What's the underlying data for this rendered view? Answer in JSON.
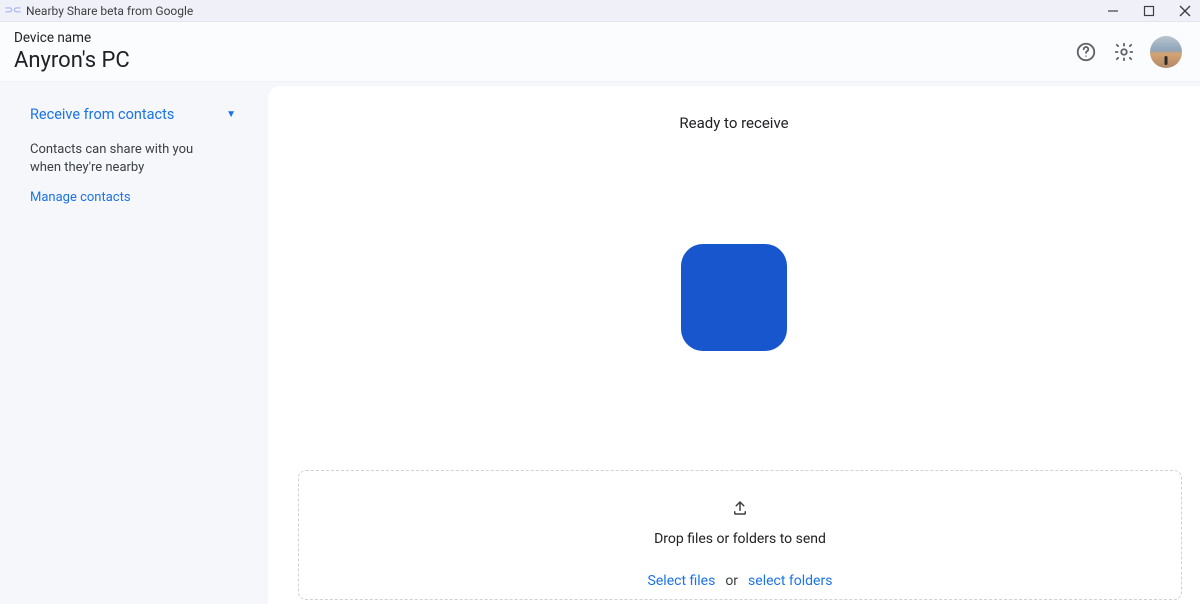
{
  "window": {
    "title": "Nearby Share beta from Google"
  },
  "header": {
    "device_label": "Device name",
    "device_name": "Anyron's PC"
  },
  "sidebar": {
    "receive_mode": "Receive from contacts",
    "description": "Contacts can share with you when they're nearby",
    "manage_link": "Manage contacts"
  },
  "main": {
    "ready_label": "Ready to receive",
    "drop_label": "Drop files or folders to send",
    "select_files": "Select files",
    "or": "or",
    "select_folders": "select folders"
  },
  "colors": {
    "accent": "#1a73e8",
    "icon_square": "#1756cc"
  }
}
